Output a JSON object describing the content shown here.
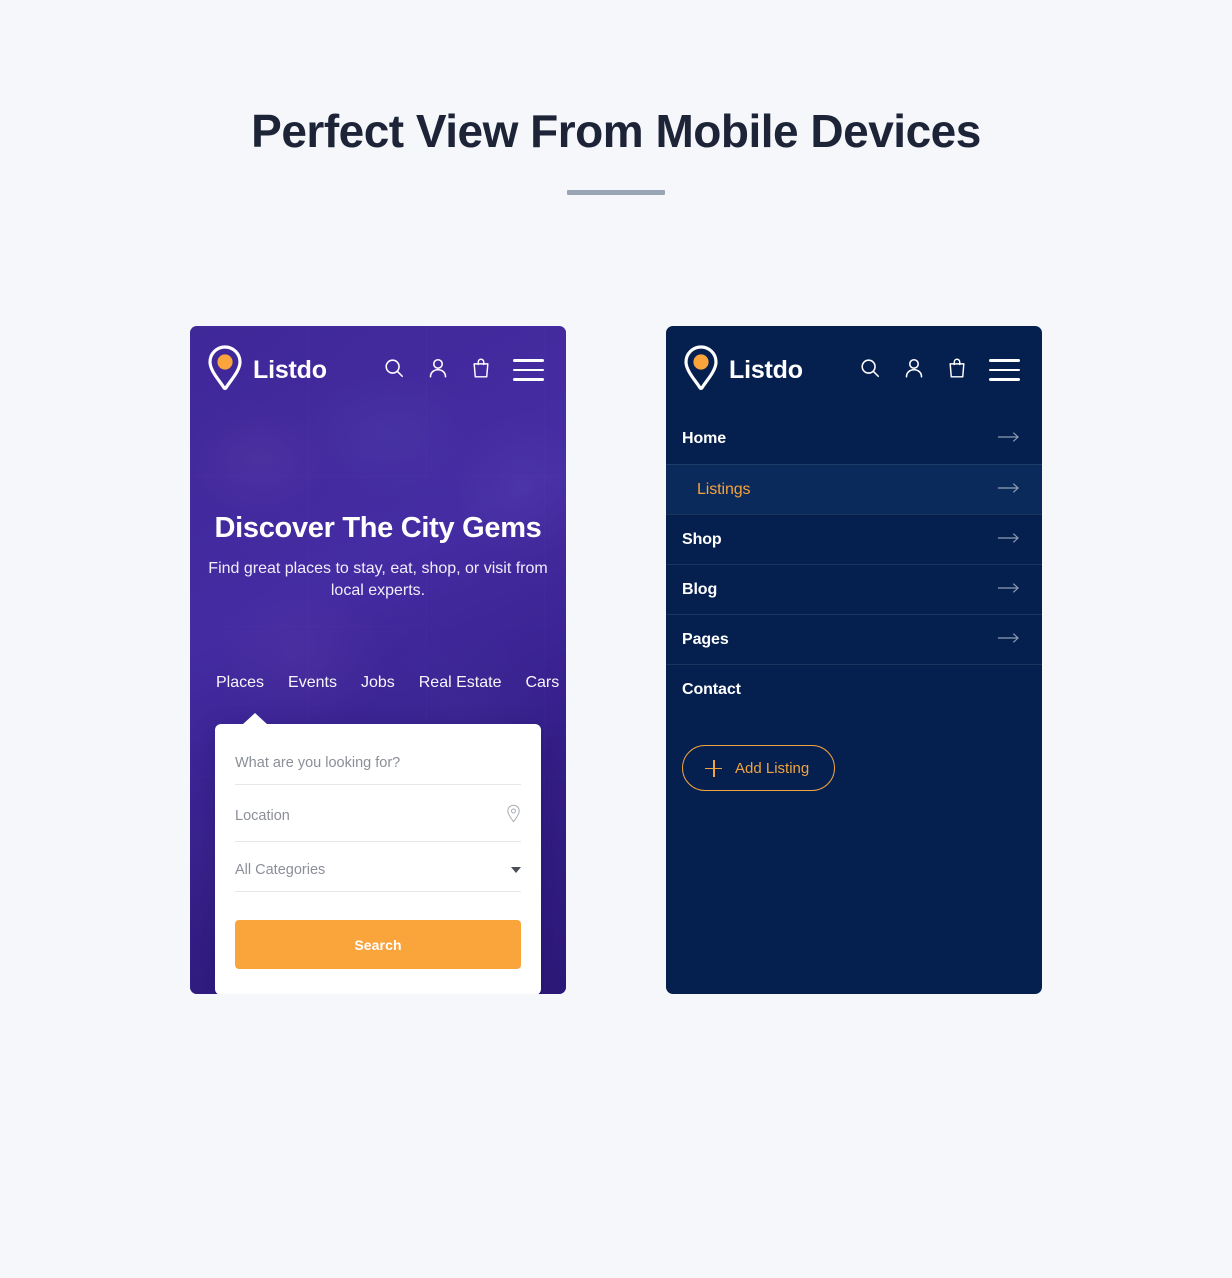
{
  "section": {
    "title": "Perfect View From Mobile Devices"
  },
  "colors": {
    "page_bg": "#f6f7fa",
    "title": "#1e2438",
    "rule": "#99a4b4",
    "accent_orange": "#faa43c",
    "navy": "#05204f",
    "hero_purple": "#3a2395"
  },
  "brand": {
    "name": "Listdo",
    "logo_icon": "map-pin-icon"
  },
  "topbar": {
    "icons": [
      {
        "name": "search-icon",
        "label": "Search"
      },
      {
        "name": "user-icon",
        "label": "Account"
      },
      {
        "name": "shopping-bag-icon",
        "label": "Cart"
      },
      {
        "name": "hamburger-menu-icon",
        "label": "Menu"
      }
    ]
  },
  "phone_left": {
    "hero": {
      "title": "Discover The City Gems",
      "subtitle": "Find great places to stay, eat, shop, or visit from local experts."
    },
    "tabs": [
      {
        "label": "Places",
        "active": true
      },
      {
        "label": "Events",
        "active": false
      },
      {
        "label": "Jobs",
        "active": false
      },
      {
        "label": "Real Estate",
        "active": false
      },
      {
        "label": "Cars",
        "active": false
      }
    ],
    "search_form": {
      "keyword_placeholder": "What are you looking for?",
      "keyword_value": "",
      "location_placeholder": "Location",
      "location_value": "",
      "location_icon": "location-pin-icon",
      "category_selected": "All Categories",
      "category_icon": "chevron-down-icon",
      "submit_label": "Search"
    }
  },
  "phone_right": {
    "menu": [
      {
        "label": "Home",
        "active": false,
        "arrow": true
      },
      {
        "label": "Listings",
        "active": true,
        "arrow": true
      },
      {
        "label": "Shop",
        "active": false,
        "arrow": true
      },
      {
        "label": "Blog",
        "active": false,
        "arrow": true
      },
      {
        "label": "Pages",
        "active": false,
        "arrow": true
      },
      {
        "label": "Contact",
        "active": false,
        "arrow": false
      }
    ],
    "add_listing": {
      "label": "Add Listing",
      "icon": "plus-icon"
    }
  }
}
